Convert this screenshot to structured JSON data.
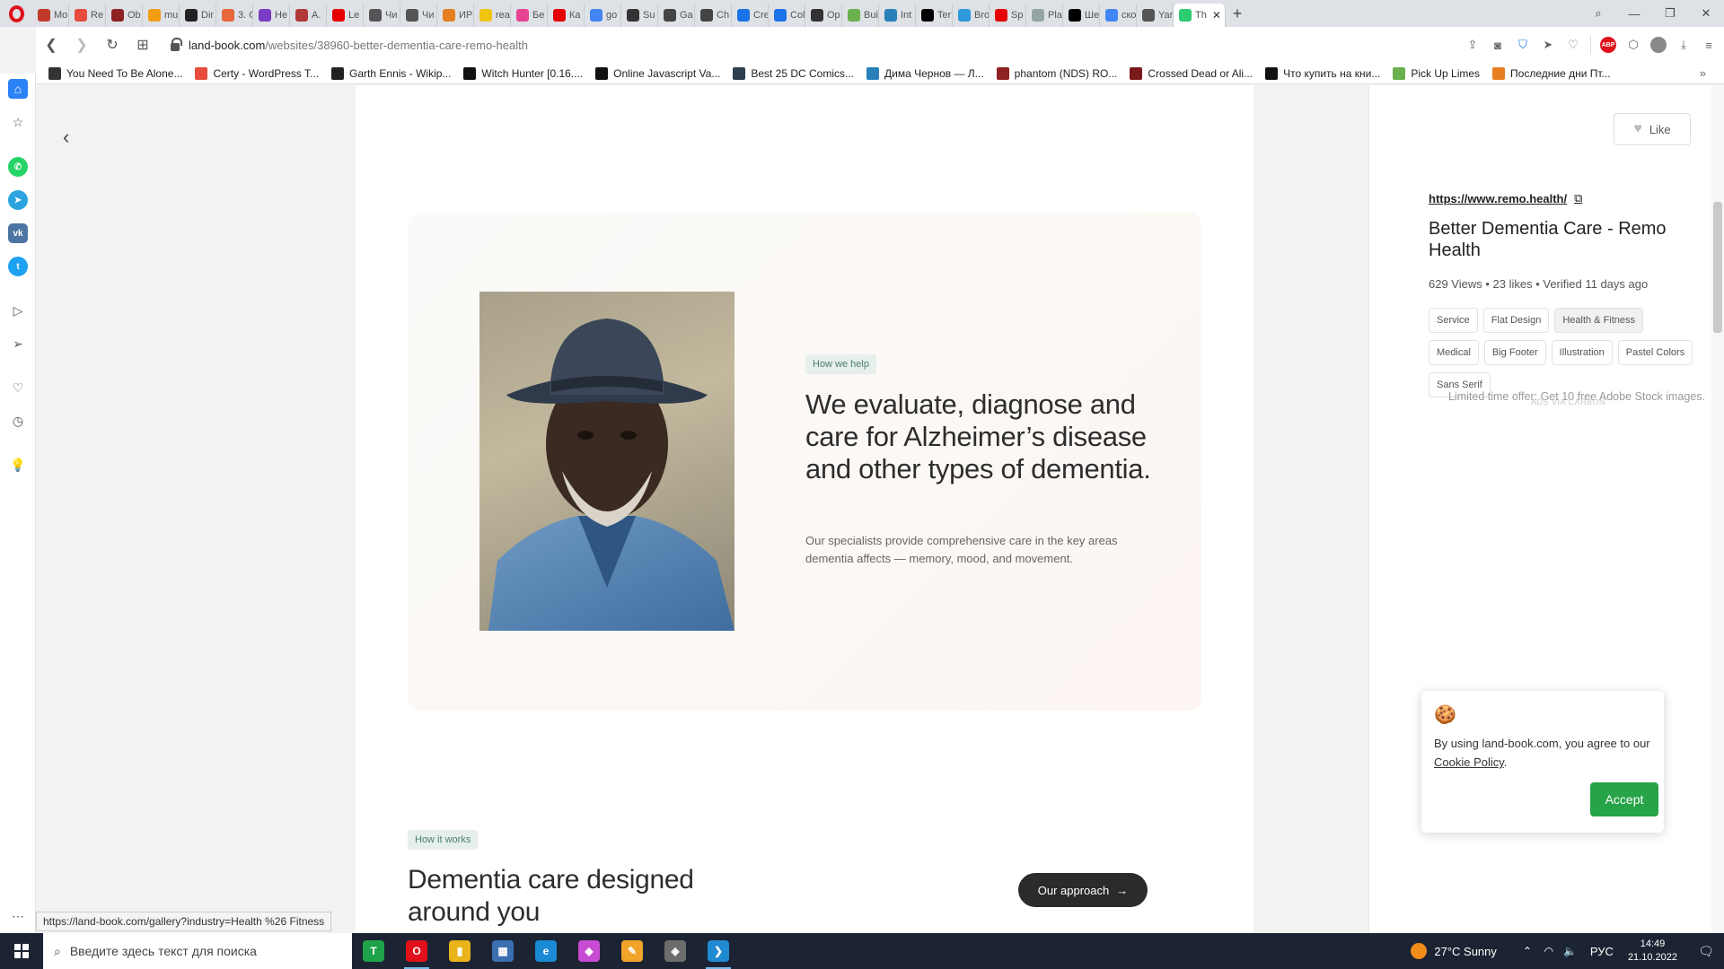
{
  "browser": {
    "tabs": [
      {
        "label": "Mo",
        "color": "#c0392b"
      },
      {
        "label": "Re",
        "color": "#e74c3c"
      },
      {
        "label": "Ob",
        "color": "#8e2121"
      },
      {
        "label": "mu",
        "color": "#f39c12"
      },
      {
        "label": "Dir",
        "color": "#222222"
      },
      {
        "label": "3. C",
        "color": "#e8663c"
      },
      {
        "label": "He",
        "color": "#7a3cc4"
      },
      {
        "label": "A.",
        "color": "#b33939"
      },
      {
        "label": "Le",
        "color": "#e60000"
      },
      {
        "label": "Чи",
        "color": "#555555"
      },
      {
        "label": "Чи",
        "color": "#555555"
      },
      {
        "label": "ИР",
        "color": "#e67e22"
      },
      {
        "label": "rea",
        "color": "#f1c40f"
      },
      {
        "label": "Бе",
        "color": "#e84393"
      },
      {
        "label": "Ка",
        "color": "#e60000"
      },
      {
        "label": "go",
        "color": "#4285f4"
      },
      {
        "label": "Su",
        "color": "#333333"
      },
      {
        "label": "Ga",
        "color": "#444444"
      },
      {
        "label": "Ch",
        "color": "#444444"
      },
      {
        "label": "Cre",
        "color": "#1a73e8"
      },
      {
        "label": "Col",
        "color": "#1a73e8"
      },
      {
        "label": "Op",
        "color": "#333333"
      },
      {
        "label": "Bui",
        "color": "#6ab04c"
      },
      {
        "label": "Int",
        "color": "#2980b9"
      },
      {
        "label": "Ter",
        "color": "#000000"
      },
      {
        "label": "Bro",
        "color": "#2d98da"
      },
      {
        "label": "Sp",
        "color": "#e60000"
      },
      {
        "label": "Pla",
        "color": "#95a5a6"
      },
      {
        "label": "Ше",
        "color": "#000000"
      },
      {
        "label": "ско",
        "color": "#4285f4"
      },
      {
        "label": "Yar",
        "color": "#555555"
      },
      {
        "label": "Th",
        "color": "#2ecc71",
        "active": true
      }
    ],
    "url_host": "land-book.com",
    "url_path": "/websites/38960-better-dementia-care-remo-health",
    "bookmarks": [
      {
        "label": "You Need To Be Alone...",
        "color": "#333333"
      },
      {
        "label": "Certy - WordPress T...",
        "color": "#e74c3c"
      },
      {
        "label": "Garth Ennis - Wikip...",
        "color": "#222222"
      },
      {
        "label": "Witch Hunter [0.16....",
        "color": "#111111"
      },
      {
        "label": "Online Javascript Va...",
        "color": "#111111"
      },
      {
        "label": "Best 25 DC Comics...",
        "color": "#2c3e50"
      },
      {
        "label": "Дима Чернов — Л...",
        "color": "#2980b9"
      },
      {
        "label": "phantom (NDS) RO...",
        "color": "#8e2121"
      },
      {
        "label": "Crossed Dead or Ali...",
        "color": "#7b1a1a"
      },
      {
        "label": "Что купить на кни...",
        "color": "#111111"
      },
      {
        "label": "Pick Up Limes",
        "color": "#6ab04c"
      },
      {
        "label": "Последние дни Пт...",
        "color": "#e67e22"
      }
    ]
  },
  "site": {
    "help_badge": "How we help",
    "hero_title": "We evaluate, diagnose and care for Alzheimer’s disease and other types of dementia.",
    "hero_text": "Our specialists provide comprehensive care in the key areas dementia affects — memory, mood, and movement.",
    "works_badge": "How it works",
    "works_title": "Dementia care designed around you",
    "approach_button": "Our approach"
  },
  "panel": {
    "like_label": "Like",
    "link": "https://www.remo.health/",
    "title": "Better Dementia Care - Remo Health",
    "meta": "629 Views • 23 likes • Verified 11 days ago",
    "tags": [
      "Service",
      "Flat Design",
      "Health & Fitness",
      "Medical",
      "Big Footer",
      "Illustration",
      "Pastel Colors",
      "Sans Serif"
    ],
    "ad_text": "Limited time offer: Get 10 free Adobe Stock images.",
    "ad_sub": "ADS VIA CARBON"
  },
  "cookie": {
    "text_prefix": "By using land-book.com, you agree to our ",
    "link": "Cookie Policy",
    "text_suffix": ".",
    "accept": "Accept"
  },
  "status_url": "https://land-book.com/gallery?industry=Health %26 Fitness",
  "taskbar": {
    "search_placeholder": "Введите здесь текст для поиска",
    "weather": "27°C  Sunny",
    "lang": "РУС",
    "time": "14:49",
    "date": "21.10.2022",
    "apps": [
      {
        "name": "trello",
        "color": "#1fa34a",
        "glyph": "T"
      },
      {
        "name": "opera",
        "color": "#e0111a",
        "glyph": "O",
        "active": true
      },
      {
        "name": "explorer",
        "color": "#e8b41a",
        "glyph": "▮"
      },
      {
        "name": "calculator",
        "color": "#3a6fb0",
        "glyph": "▦"
      },
      {
        "name": "edge",
        "color": "#1a8ad4",
        "glyph": "e"
      },
      {
        "name": "color-picker",
        "color": "#c84bd3",
        "glyph": "◆"
      },
      {
        "name": "pencil",
        "color": "#f0a52a",
        "glyph": "✎"
      },
      {
        "name": "game",
        "color": "#6d6d6d",
        "glyph": "◈"
      },
      {
        "name": "vscode",
        "color": "#1f8ad2",
        "glyph": "❯",
        "active": true
      }
    ]
  }
}
